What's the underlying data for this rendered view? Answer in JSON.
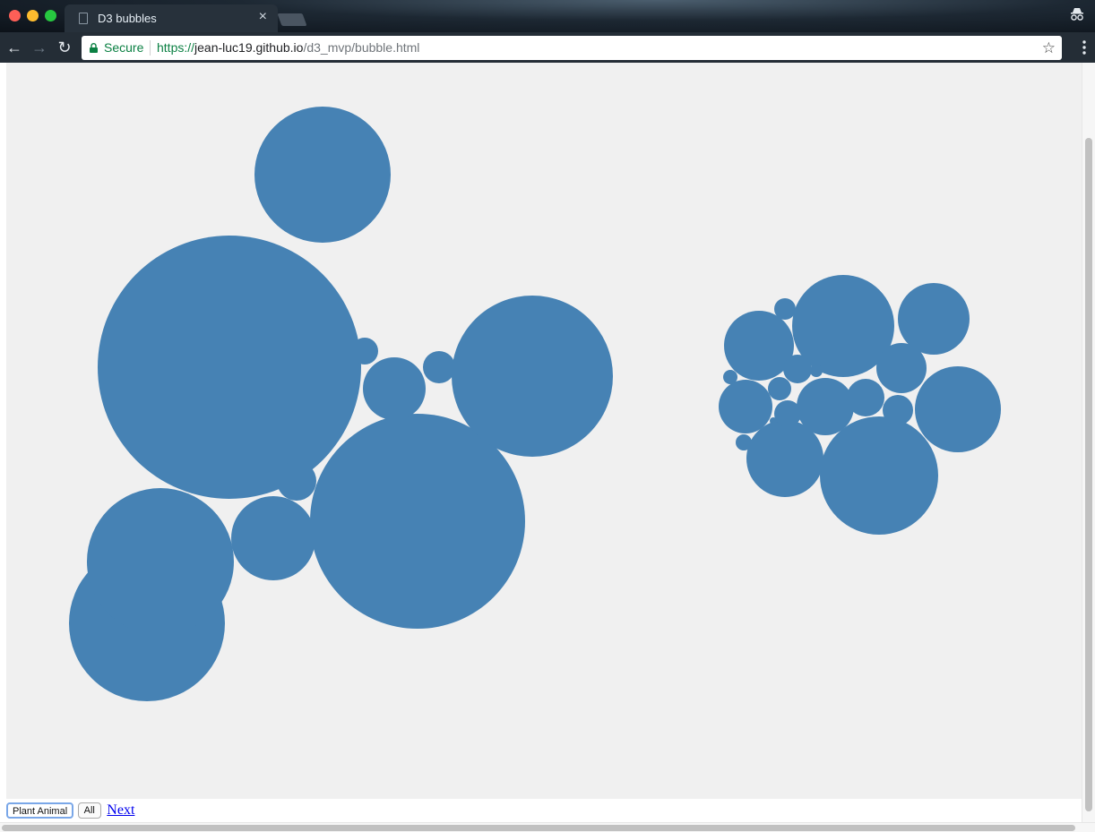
{
  "window": {
    "tab_title": "D3 bubbles",
    "tab_close": "×"
  },
  "toolbar": {
    "secure_label": "Secure",
    "url_scheme": "https://",
    "url_host": "jean-luc19.github.io",
    "url_path": "/d3_mvp/bubble.html",
    "back_glyph": "←",
    "forward_glyph": "→",
    "reload_glyph": "↻",
    "star_glyph": "☆"
  },
  "controls": {
    "plant_animal_label": "Plant Animal",
    "all_label": "All",
    "next_label": "Next",
    "active_button": "Plant Animal"
  },
  "colors": {
    "bubble_fill": "#4682b4",
    "chart_background": "#f0f0f0"
  },
  "chart_data": {
    "type": "bubble",
    "title": "",
    "groups": [
      "Plant",
      "Animal"
    ],
    "value_unit": "radius (relative)",
    "bubbles": [
      {
        "group": "Plant",
        "r": 147
      },
      {
        "group": "Plant",
        "r": 120
      },
      {
        "group": "Plant",
        "r": 90
      },
      {
        "group": "Plant",
        "r": 87
      },
      {
        "group": "Plant",
        "r": 82
      },
      {
        "group": "Plant",
        "r": 76
      },
      {
        "group": "Plant",
        "r": 47
      },
      {
        "group": "Plant",
        "r": 35
      },
      {
        "group": "Plant",
        "r": 22
      },
      {
        "group": "Plant",
        "r": 18
      },
      {
        "group": "Plant",
        "r": 15
      },
      {
        "group": "Animal",
        "r": 66
      },
      {
        "group": "Animal",
        "r": 57
      },
      {
        "group": "Animal",
        "r": 48
      },
      {
        "group": "Animal",
        "r": 43
      },
      {
        "group": "Animal",
        "r": 40
      },
      {
        "group": "Animal",
        "r": 39
      },
      {
        "group": "Animal",
        "r": 32
      },
      {
        "group": "Animal",
        "r": 30
      },
      {
        "group": "Animal",
        "r": 28
      },
      {
        "group": "Animal",
        "r": 21
      },
      {
        "group": "Animal",
        "r": 17
      },
      {
        "group": "Animal",
        "r": 16
      },
      {
        "group": "Animal",
        "r": 15
      },
      {
        "group": "Animal",
        "r": 13
      },
      {
        "group": "Animal",
        "r": 12
      },
      {
        "group": "Animal",
        "r": 9
      },
      {
        "group": "Animal",
        "r": 8
      },
      {
        "group": "Animal",
        "r": 7
      },
      {
        "group": "Animal",
        "r": 4
      }
    ]
  }
}
